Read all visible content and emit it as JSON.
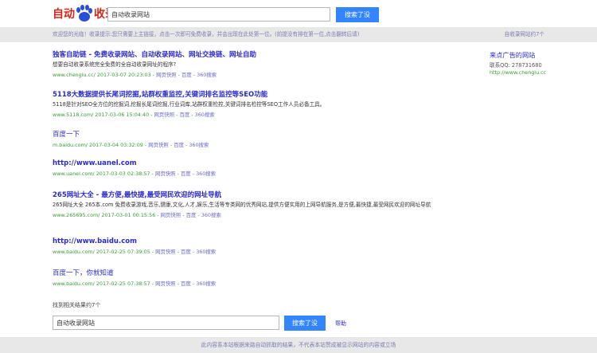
{
  "header": {
    "logo_text_left": "自动",
    "logo_paw_text": "收录",
    "logo_text_right": "收录",
    "search_value": "自动收录网站",
    "search_button": "搜索了没"
  },
  "notice": {
    "message": "欢迎您的光临！收录提示:您只需要上主链接，点击一次即可免费收录，并会出现在此处第一位。(前提没有排在第一位,点击翻转后请)",
    "result_count": "自收录网站约7个"
  },
  "results": [
    {
      "title": "独客自助链 - 免费收录网站、自动收录网站、网址交换链、网址自助",
      "desc": "想要自动收录系统完全免费的全自动收录网址的程序?",
      "url": "www.chenglu.cc/",
      "time": "2017-03-07 20:23:03",
      "snapshot": "网页快照",
      "baidu": "百度",
      "s360": "360搜索"
    },
    {
      "title": "5118大数据提供长尾词挖掘,站群权重监控,关键词排名监控等SEO功能",
      "desc": "5118是针对SEO全方位的挖掘词,挖掘长尾词挖掘,行业词库,站群权重检控,关键词排名检控等SEO工作人员必备工具。",
      "url": "www.5118.com/",
      "time": "2017-03-06 15:04:40",
      "snapshot": "网页快照",
      "baidu": "百度",
      "s360": "360搜索"
    },
    {
      "title": "百度一下",
      "desc": "",
      "url": "m.baidu.com/",
      "time": "2017-03-04 03:32:09",
      "snapshot": "网页快照",
      "baidu": "百度",
      "s360": "360搜索"
    },
    {
      "title": "http://www.uanel.com",
      "desc": "",
      "url": "www.uanel.com/",
      "time": "2017-03-03 02:38:57",
      "snapshot": "网页快照",
      "baidu": "百度",
      "s360": "360搜索"
    },
    {
      "title": "265网址大全 - 最方便,最快捷,最受网民欢迎的网址导航",
      "desc": "265网址大全 265本.com 免费收录游戏,音乐,健康,文化,人才,娱乐,生活等专类网的优秀网站,提供方便实用的上网导航服务,是方便,最快捷,最受网民欢迎的网址导航",
      "url": "www.265695.com/",
      "time": "2017-03-01 00:15:56",
      "snapshot": "网页快照",
      "baidu": "百度",
      "s360": "360搜索"
    },
    {
      "title": "http://www.baidu.com",
      "desc": "",
      "url": "www.baidu.com/",
      "time": "2017-02-25 07:39:05",
      "snapshot": "网页快照",
      "baidu": "百度",
      "s360": "360搜索"
    },
    {
      "title": "百度一下，你就知道",
      "desc": "",
      "url": "www.baidu.com/",
      "time": "2017-02-25 07:38:57",
      "snapshot": "网页快照",
      "baidu": "百度",
      "s360": "360搜索"
    }
  ],
  "sidebar": {
    "name": "来点广告的网站",
    "qq": "联系QQ: 278731680",
    "url": "http://www.chenglu.cc"
  },
  "bottom": {
    "found_text": "找到相关结果约7个",
    "search_value": "自动收录网站",
    "search_button": "搜索了没",
    "help": "帮助"
  },
  "footer": {
    "text": "此内容系本站根据来路自动抓取的结果，不代表本站赞成被显示网站的内容或立场"
  },
  "colors": {
    "accent_blue": "#3385ff",
    "link_blue": "#2b2bcc",
    "url_green": "#3a9a3a",
    "logo_red": "#d9261c"
  }
}
